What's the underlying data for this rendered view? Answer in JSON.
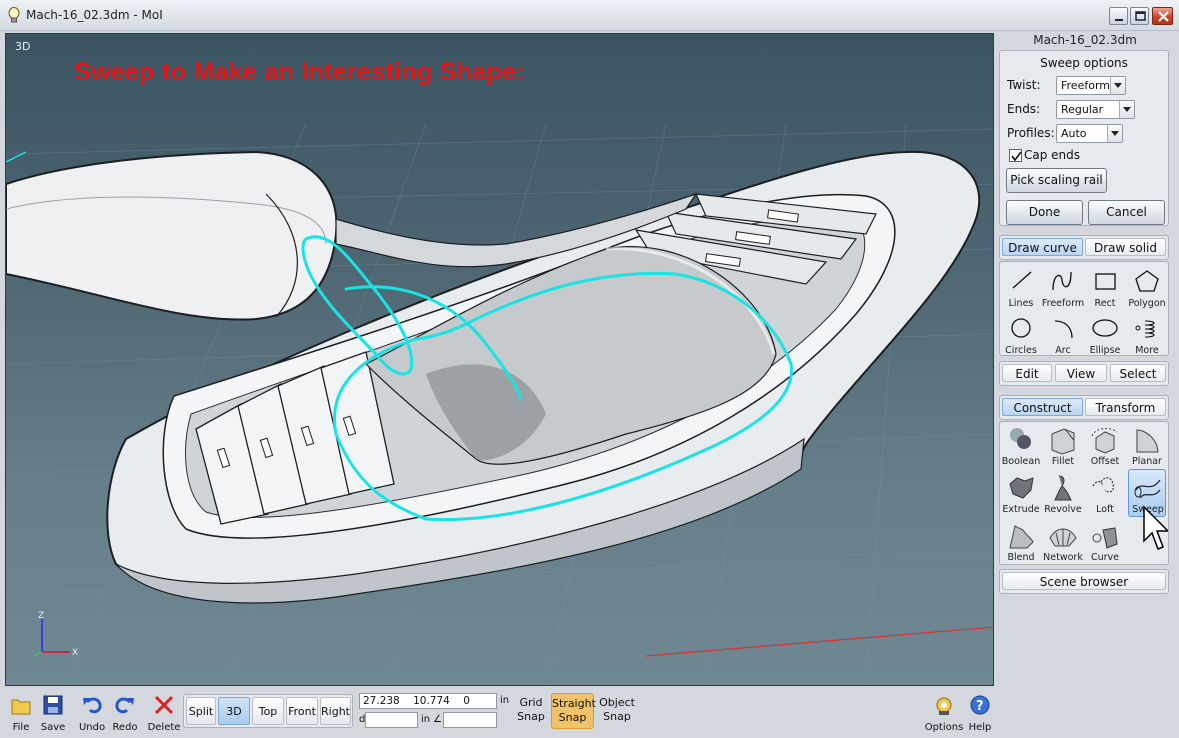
{
  "window": {
    "title": "Mach-16_02.3dm - MoI"
  },
  "viewport": {
    "label": "3D",
    "caption": "Sweep to Make an Interesting Shape:",
    "axes": {
      "z": "Z",
      "x": "X"
    }
  },
  "panel": {
    "filename": "Mach-16_02.3dm",
    "sweep_options": {
      "title": "Sweep options",
      "twist_label": "Twist:",
      "twist_value": "Freeform",
      "ends_label": "Ends:",
      "ends_value": "Regular",
      "profiles_label": "Profiles:",
      "profiles_value": "Auto",
      "cap_ends_label": "Cap ends",
      "cap_ends_checked": true,
      "pick_scaling_rail": "Pick scaling rail",
      "done": "Done",
      "cancel": "Cancel"
    },
    "draw_tabs": {
      "curve": "Draw curve",
      "solid": "Draw solid",
      "active": "curve"
    },
    "draw_tools": [
      "Lines",
      "Freeform",
      "Rect",
      "Polygon",
      "Circles",
      "Arc",
      "Ellipse",
      "More"
    ],
    "mode_tabs": [
      "Edit",
      "View",
      "Select"
    ],
    "construct_tabs": {
      "construct": "Construct",
      "transform": "Transform",
      "active": "construct"
    },
    "construct_tools": [
      "Boolean",
      "Fillet",
      "Offset",
      "Planar",
      "Extrude",
      "Revolve",
      "Loft",
      "Sweep",
      "Blend",
      "Network",
      "Curve"
    ],
    "selected_tool": "Sweep",
    "scene_browser": "Scene browser"
  },
  "bottombar": {
    "file": "File",
    "save": "Save",
    "undo": "Undo",
    "redo": "Redo",
    "delete": "Delete",
    "views": [
      "Split",
      "3D",
      "Top",
      "Front",
      "Right"
    ],
    "active_view": "3D",
    "coords": {
      "x": "27.238",
      "y": "10.774",
      "z": "0",
      "unit": "in",
      "d_label": "d",
      "d_unit": "in",
      "angle_label": "∠"
    },
    "grid_snap": "Grid\nSnap",
    "straight_snap": "Straight\nSnap",
    "object_snap": "Object\nSnap",
    "options": "Options",
    "help": "Help"
  },
  "colors": {
    "caption": "#e01515",
    "curves": "#19e3e3",
    "accent": "#a9cdf1"
  }
}
